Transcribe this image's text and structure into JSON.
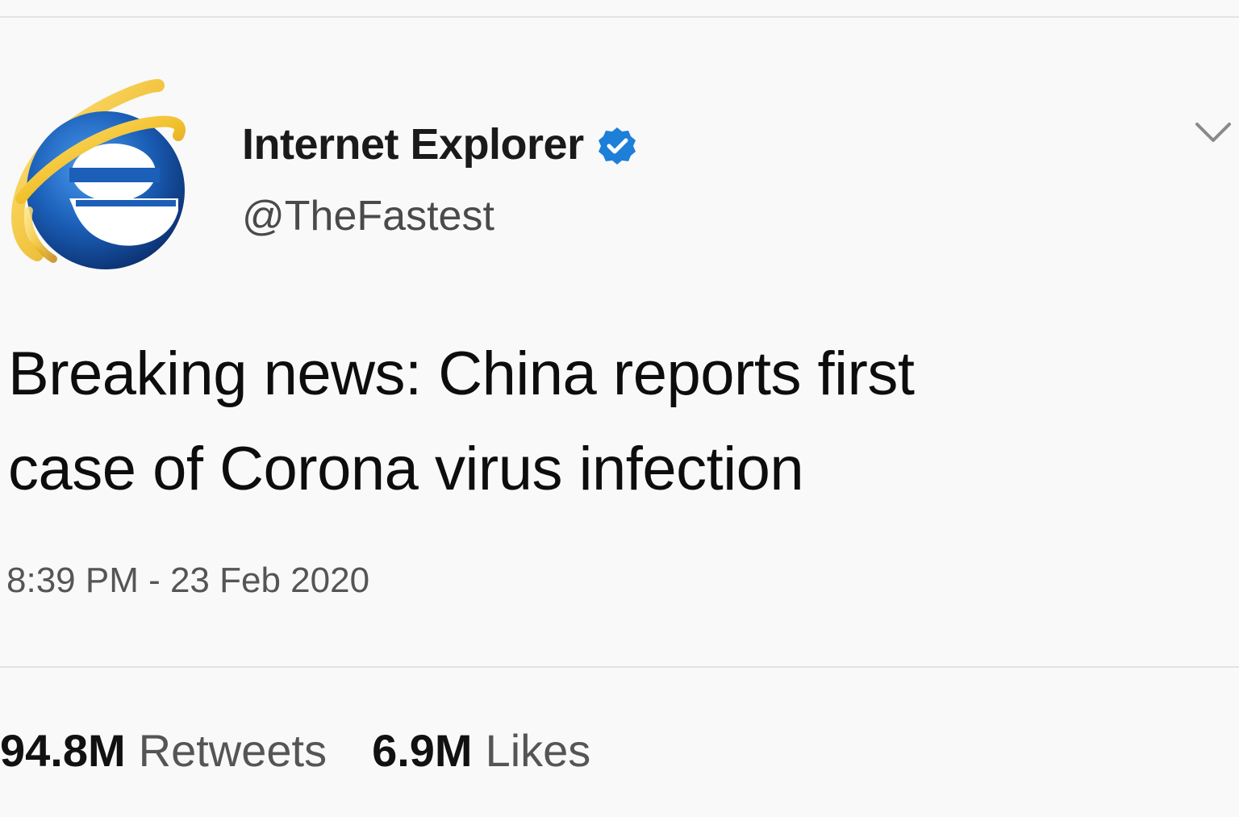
{
  "author": {
    "display_name": "Internet Explorer",
    "handle": "@TheFastest",
    "avatar_icon": "internet-explorer-logo-icon",
    "verified_icon": "verified-badge-icon"
  },
  "tweet": {
    "text_lines": [
      "Breaking news: China reports first",
      "case of Corona virus infection"
    ],
    "timestamp": "8:39 PM - 23 Feb 2020"
  },
  "stats": {
    "retweets_count": "94.8M",
    "retweets_label": "Retweets",
    "likes_count": "6.9M",
    "likes_label": "Likes"
  },
  "menu": {
    "caret_icon": "chevron-down-icon"
  },
  "colors": {
    "verified_blue": "#1d7fd8",
    "ie_blue": "#1b5fb8",
    "ie_gold": "#f2c12e"
  }
}
